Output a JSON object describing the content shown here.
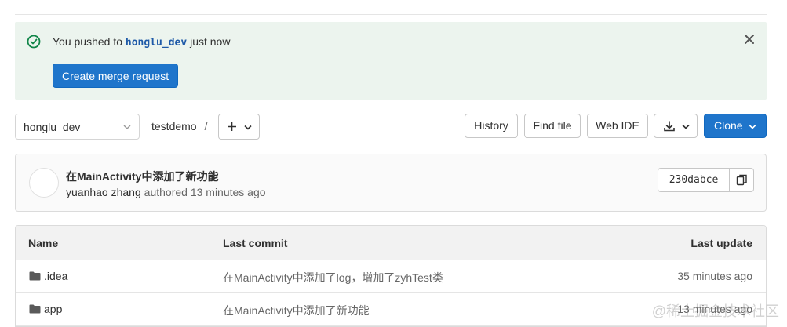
{
  "alert": {
    "prefix": "You pushed to ",
    "branch": "honglu_dev",
    "suffix": " just now",
    "button": "Create merge request",
    "success_color": "#108548"
  },
  "toolbar": {
    "branch": "honglu_dev",
    "breadcrumb": "testdemo",
    "separator": "/",
    "history": "History",
    "find_file": "Find file",
    "web_ide": "Web IDE",
    "clone": "Clone",
    "accent": "#1f75cb"
  },
  "commit": {
    "title": "在MainActivity中添加了新功能",
    "author": "yuanhao zhang",
    "meta": " authored 13 minutes ago",
    "sha": "230dabce"
  },
  "table": {
    "headers": [
      "Name",
      "Last commit",
      "Last update"
    ],
    "rows": [
      {
        "icon": "folder-icon",
        "name": ".idea",
        "commit": "在MainActivity中添加了log，增加了zyhTest类",
        "updated": "35 minutes ago"
      },
      {
        "icon": "folder-icon",
        "name": "app",
        "commit": "在MainActivity中添加了新功能",
        "updated": "13 minutes ago"
      }
    ]
  },
  "watermark": "@稀土掘金技术社区"
}
